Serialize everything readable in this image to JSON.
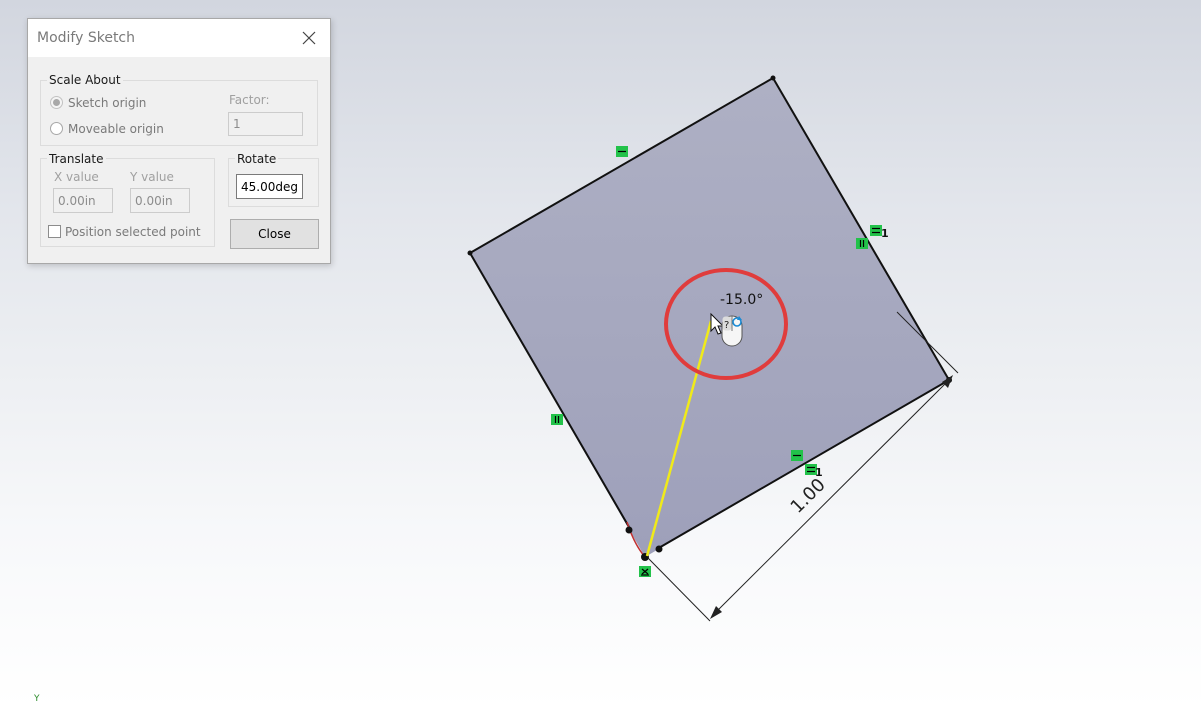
{
  "dialog": {
    "title": "Modify Sketch",
    "scale_group": {
      "legend": "Scale About",
      "sketch_origin_label": "Sketch origin",
      "sketch_origin_selected": true,
      "moveable_origin_label": "Moveable origin",
      "factor_label": "Factor:",
      "factor_value": "1"
    },
    "translate_group": {
      "legend": "Translate",
      "x_label": "X value",
      "x_value": "0.00in",
      "y_label": "Y value",
      "y_value": "0.00in",
      "position_selected_label": "Position selected point",
      "position_selected_checked": false
    },
    "rotate_group": {
      "legend": "Rotate",
      "value": "45.00deg"
    },
    "close_button_label": "Close"
  },
  "sketch": {
    "rotation_readout": "-15.0°",
    "dimension_label": "1.00",
    "relation_index_label": "1",
    "triad_axis_label": "Y",
    "colors": {
      "square_fill_top": "#aeb0c4",
      "square_fill_bottom": "#9ea0ba",
      "edge": "#111111",
      "rotate_line": "#f0ea1a",
      "ring": "#e03c3c",
      "relation_green": "#22c24a",
      "triad_y": "#2a8a2a"
    },
    "icons": [
      "horizontal-relation-icon",
      "vertical-relation-icon",
      "fixed-relation-icon",
      "cursor-arrow-icon",
      "mouse-icon",
      "rotate-icon"
    ]
  }
}
